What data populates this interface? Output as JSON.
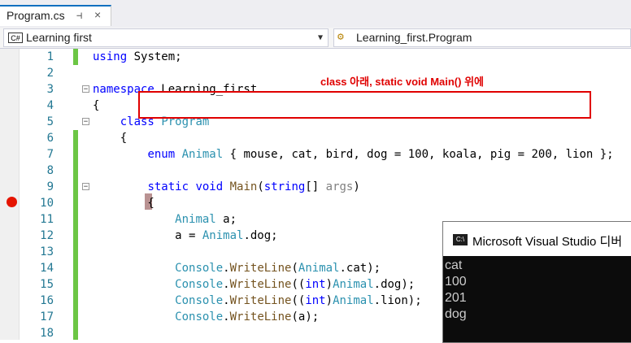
{
  "tab": {
    "title": "Program.cs",
    "pin": "⊣",
    "close": "×"
  },
  "nav": {
    "project_icon": "C#",
    "project": "Learning first",
    "member": "Learning_first.Program"
  },
  "line_numbers": [
    "1",
    "2",
    "3",
    "4",
    "5",
    "6",
    "7",
    "8",
    "9",
    "10",
    "11",
    "12",
    "13",
    "14",
    "15",
    "16",
    "17",
    "18"
  ],
  "annotation": "class 아래, static void Main() 위에",
  "console": {
    "icon": "C:\\",
    "title": "Microsoft Visual Studio 디버",
    "output": [
      "cat",
      "100",
      "201",
      "dog"
    ]
  }
}
